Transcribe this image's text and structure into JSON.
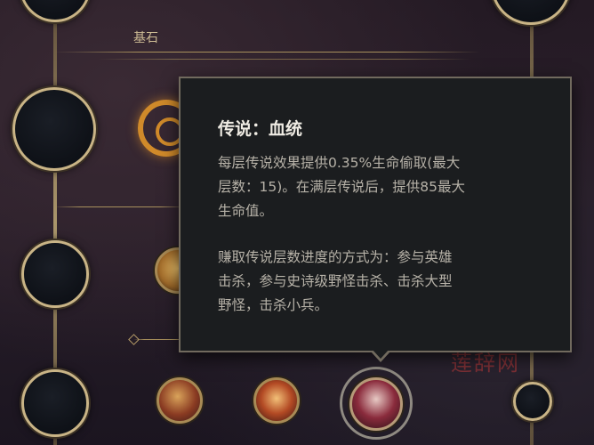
{
  "section": {
    "label": "基石"
  },
  "tooltip": {
    "title": "传说：血统",
    "paragraph1": "每层传说效果提供0.35%生命偷取(最大\n层数：15)。在满层传说后，提供85最大\n生命值。",
    "paragraph2": "赚取传说层数进度的方式为：参与英雄\n击杀，参与史诗级野怪击杀、击杀大型\n野怪，击杀小兵。"
  },
  "watermark": {
    "text": "莲辞网"
  },
  "runes": [
    {
      "icon": "legend-alacrity-rune-icon",
      "state": "unselected"
    },
    {
      "icon": "legend-tenacity-rune-icon",
      "state": "unselected"
    },
    {
      "icon": "legend-bloodline-rune-icon",
      "state": "selected"
    }
  ],
  "colors": {
    "accent_gold": "#c9b486",
    "keystone_orange": "#d08a2a",
    "tooltip_bg": "#1b1d1f"
  }
}
